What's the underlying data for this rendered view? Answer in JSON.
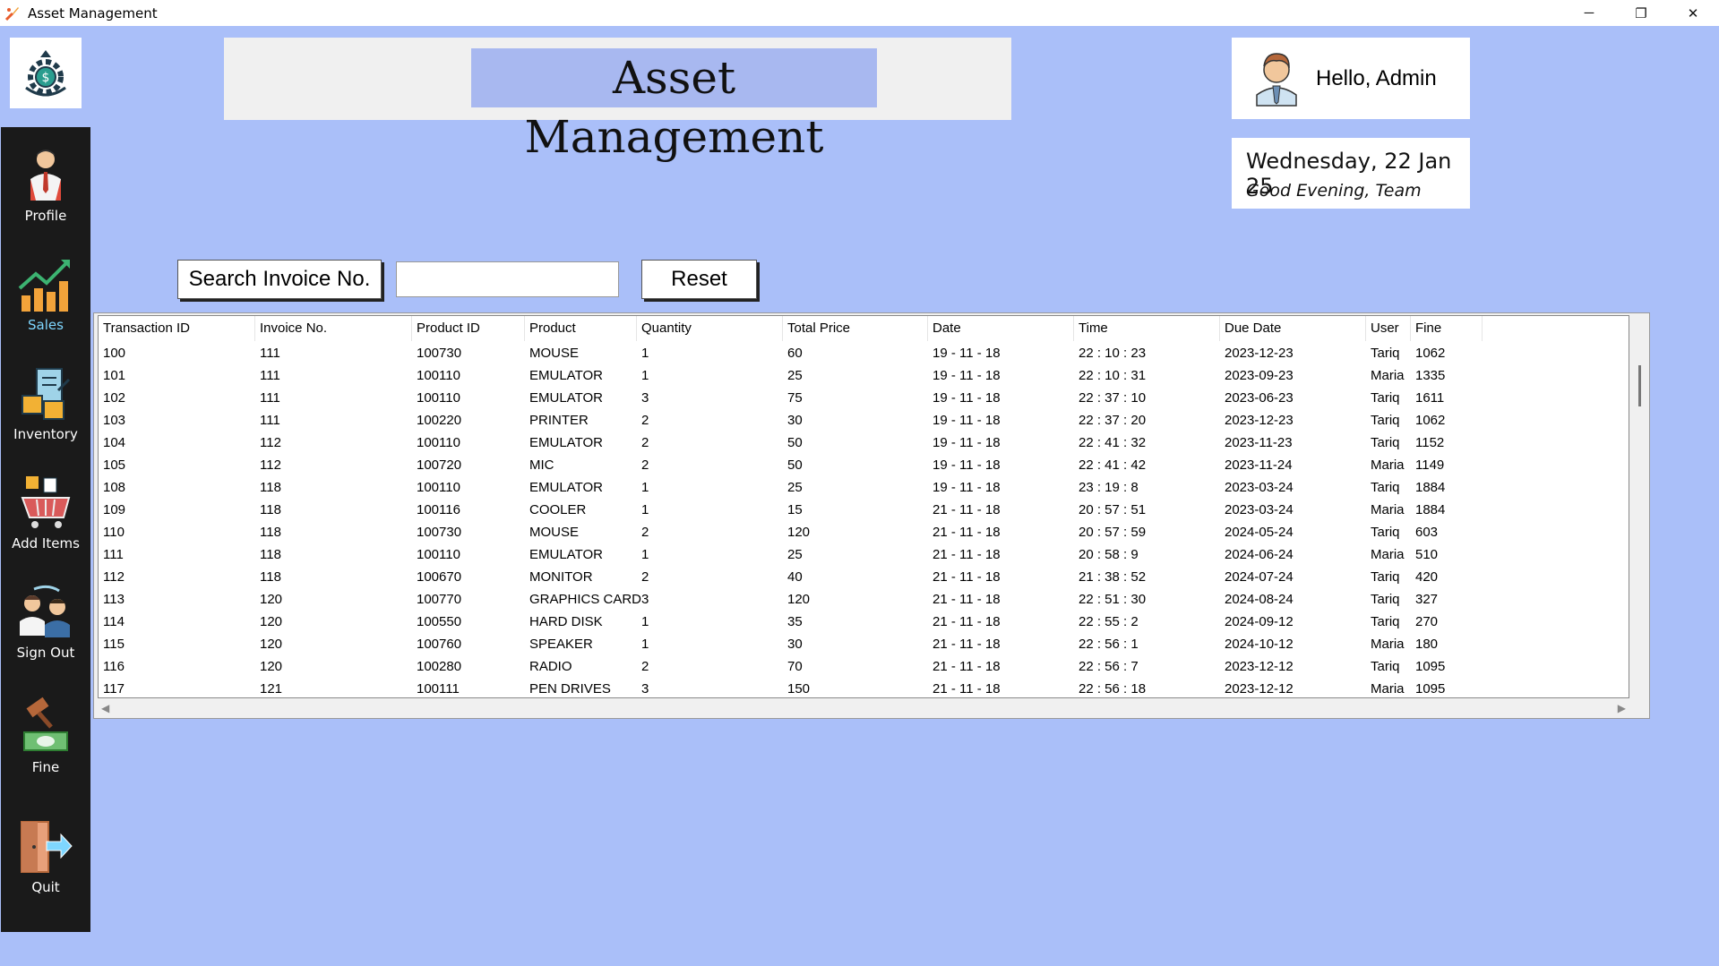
{
  "window": {
    "title": "Asset Management",
    "controls": [
      "─",
      "❐",
      "✕"
    ]
  },
  "sidebar": {
    "items": [
      {
        "label": "Profile",
        "icon": "profile-icon"
      },
      {
        "label": "Sales",
        "icon": "sales-chart-icon",
        "active": true
      },
      {
        "label": "Inventory",
        "icon": "inventory-icon"
      },
      {
        "label": "Add Items",
        "icon": "cart-icon"
      },
      {
        "label": "Sign Out",
        "icon": "sign-out-icon"
      },
      {
        "label": "Fine",
        "icon": "gavel-icon"
      },
      {
        "label": "Quit",
        "icon": "exit-door-icon"
      }
    ]
  },
  "header": {
    "title": "Asset Management"
  },
  "user": {
    "greeting": "Hello, Admin"
  },
  "datebox": {
    "date": "Wednesday, 22 Jan 25",
    "greeting": "Good Evening, Team"
  },
  "search": {
    "button_label": "Search Invoice No.",
    "value": "",
    "reset_label": "Reset"
  },
  "table": {
    "columns": [
      "Transaction ID",
      "Invoice No.",
      "Product ID",
      "Product",
      "Quantity",
      "Total Price",
      "Date",
      "Time",
      "Due Date",
      "User",
      "Fine"
    ],
    "rows": [
      [
        "100",
        "111",
        "100730",
        "MOUSE",
        "1",
        "60",
        "19 - 11 - 18",
        "22 : 10 : 23",
        "2023-12-23",
        "Tariq",
        "1062"
      ],
      [
        "101",
        "111",
        "100110",
        "EMULATOR",
        "1",
        "25",
        "19 - 11 - 18",
        "22 : 10 : 31",
        "2023-09-23",
        "Maria",
        "1335"
      ],
      [
        "102",
        "111",
        "100110",
        "EMULATOR",
        "3",
        "75",
        "19 - 11 - 18",
        "22 : 37 : 10",
        "2023-06-23",
        "Tariq",
        "1611"
      ],
      [
        "103",
        "111",
        "100220",
        "PRINTER",
        "2",
        "30",
        "19 - 11 - 18",
        "22 : 37 : 20",
        "2023-12-23",
        "Tariq",
        "1062"
      ],
      [
        "104",
        "112",
        "100110",
        "EMULATOR",
        "2",
        "50",
        "19 - 11 - 18",
        "22 : 41 : 32",
        "2023-11-23",
        "Tariq",
        "1152"
      ],
      [
        "105",
        "112",
        "100720",
        "MIC",
        "2",
        "50",
        "19 - 11 - 18",
        "22 : 41 : 42",
        "2023-11-24",
        "Maria",
        "1149"
      ],
      [
        "108",
        "118",
        "100110",
        "EMULATOR",
        "1",
        "25",
        "19 - 11 - 18",
        "23 : 19 : 8",
        "2023-03-24",
        "Tariq",
        "1884"
      ],
      [
        "109",
        "118",
        "100116",
        "COOLER",
        "1",
        "15",
        "21 - 11 - 18",
        "20 : 57 : 51",
        "2023-03-24",
        "Maria",
        "1884"
      ],
      [
        "110",
        "118",
        "100730",
        "MOUSE",
        "2",
        "120",
        "21 - 11 - 18",
        "20 : 57 : 59",
        "2024-05-24",
        "Tariq",
        "603"
      ],
      [
        "111",
        "118",
        "100110",
        "EMULATOR",
        "1",
        "25",
        "21 - 11 - 18",
        "20 : 58 : 9",
        "2024-06-24",
        "Maria",
        "510"
      ],
      [
        "112",
        "118",
        "100670",
        "MONITOR",
        "2",
        "40",
        "21 - 11 - 18",
        "21 : 38 : 52",
        "2024-07-24",
        "Tariq",
        "420"
      ],
      [
        "113",
        "120",
        "100770",
        "GRAPHICS CARD",
        "3",
        "120",
        "21 - 11 - 18",
        "22 : 51 : 30",
        "2024-08-24",
        "Tariq",
        "327"
      ],
      [
        "114",
        "120",
        "100550",
        "HARD DISK",
        "1",
        "35",
        "21 - 11 - 18",
        "22 : 55 : 2",
        "2024-09-12",
        "Tariq",
        "270"
      ],
      [
        "115",
        "120",
        "100760",
        "SPEAKER",
        "1",
        "30",
        "21 - 11 - 18",
        "22 : 56 : 1",
        "2024-10-12",
        "Maria",
        "180"
      ],
      [
        "116",
        "120",
        "100280",
        "RADIO",
        "2",
        "70",
        "21 - 11 - 18",
        "22 : 56 : 7",
        "2023-12-12",
        "Tariq",
        "1095"
      ],
      [
        "117",
        "121",
        "100111",
        "PEN DRIVES",
        "3",
        "150",
        "21 - 11 - 18",
        "22 : 56 : 18",
        "2023-12-12",
        "Maria",
        "1095"
      ]
    ]
  }
}
